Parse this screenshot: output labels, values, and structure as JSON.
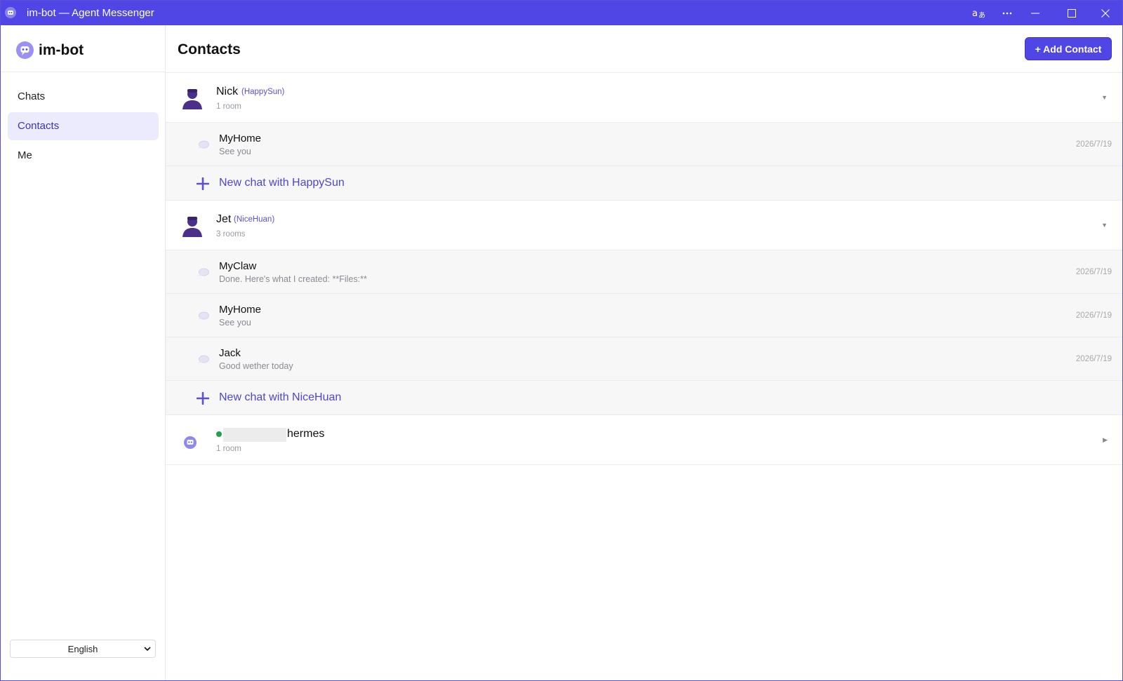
{
  "window": {
    "title": "im-bot — Agent Messenger",
    "accent": "#4f46e5"
  },
  "titlebar_icons": [
    "translate-icon",
    "more-icon",
    "minimize-icon",
    "maximize-icon",
    "close-icon"
  ],
  "sidebar": {
    "brand": "im-bot",
    "items": [
      {
        "label": "Chats",
        "active": false
      },
      {
        "label": "Contacts",
        "active": true
      },
      {
        "label": "Me",
        "active": false
      }
    ],
    "language": "English"
  },
  "main": {
    "title": "Contacts",
    "add_contact_label": "+ Add Contact",
    "contacts": [
      {
        "name": "Nick",
        "handle": "(HappySun)",
        "rooms_label": "1 room",
        "expanded": true,
        "rooms": [
          {
            "name": "MyHome",
            "last_message": "See you",
            "date": "2026/7/19"
          }
        ],
        "new_chat_label": "New chat with HappySun"
      },
      {
        "name": "Jet",
        "handle": "(NiceHuan)",
        "rooms_label": "3 rooms",
        "expanded": true,
        "rooms": [
          {
            "name": "MyClaw",
            "last_message": "Done. Here's what I created: **Files:**",
            "date": "2026/7/19"
          },
          {
            "name": "MyHome",
            "last_message": "See you",
            "date": "2026/7/19"
          },
          {
            "name": "Jack",
            "last_message": "Good wether today",
            "date": "2026/7/19"
          }
        ],
        "new_chat_label": "New chat with NiceHuan"
      },
      {
        "name_visible": "hermes",
        "rooms_label": "1 room",
        "online": true,
        "expanded": false
      }
    ]
  }
}
